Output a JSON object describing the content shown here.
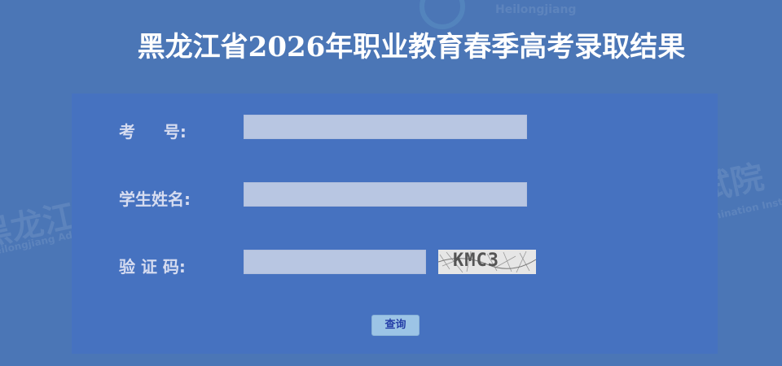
{
  "page": {
    "title": "黑龙江省2026年职业教育春季高考录取结果"
  },
  "watermarks": {
    "cn_text": "黑龙江省招生考试院",
    "en_text": "Heilongjiang Admissions and Examination Institute",
    "brand_text": "Heilongjiang"
  },
  "form": {
    "exam_number": {
      "label": "考     号:",
      "value": ""
    },
    "student_name": {
      "label": "学生姓名:",
      "value": ""
    },
    "captcha": {
      "label": "验 证 码:",
      "value": "",
      "image_text": "KMC3"
    },
    "submit_label": "查询"
  },
  "colors": {
    "background": "#4b76b6",
    "panel": "#4672c0",
    "input": "#b8c6e2",
    "button": "#9cc4e6"
  }
}
